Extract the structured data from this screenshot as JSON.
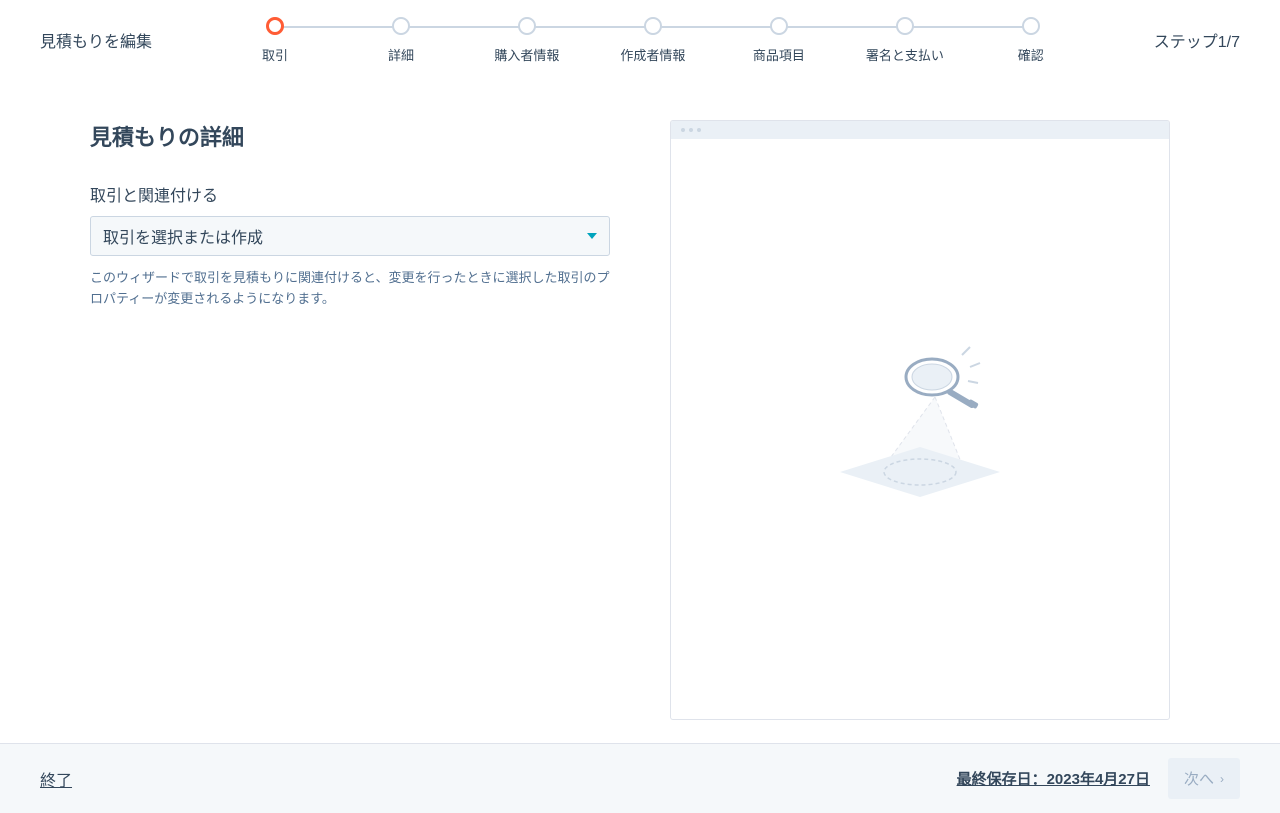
{
  "header": {
    "title": "見積もりを編集",
    "step_indicator": "ステップ1/7"
  },
  "stepper": {
    "steps": [
      {
        "label": "取引",
        "active": true
      },
      {
        "label": "詳細",
        "active": false
      },
      {
        "label": "購入者情報",
        "active": false
      },
      {
        "label": "作成者情報",
        "active": false
      },
      {
        "label": "商品項目",
        "active": false
      },
      {
        "label": "署名と支払い",
        "active": false
      },
      {
        "label": "確認",
        "active": false
      }
    ]
  },
  "main": {
    "section_title": "見積もりの詳細",
    "field_label": "取引と関連付ける",
    "select_placeholder": "取引を選択または作成",
    "help_text": "このウィザードで取引を見積もりに関連付けると、変更を行ったときに選択した取引のプロパティーが変更されるようになります。"
  },
  "footer": {
    "exit_label": "終了",
    "last_saved": "最終保存日：2023年4月27日",
    "next_label": "次へ"
  }
}
